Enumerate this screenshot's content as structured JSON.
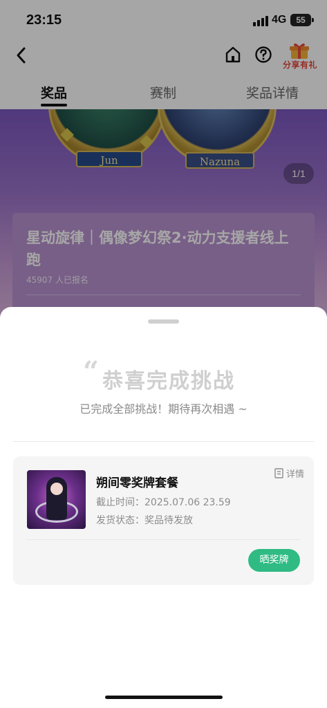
{
  "status_bar": {
    "time": "23:15",
    "network": "4G",
    "battery": "55"
  },
  "nav": {
    "share_label": "分享有礼"
  },
  "tabs": [
    {
      "label": "奖品",
      "active": true
    },
    {
      "label": "赛制",
      "active": false
    },
    {
      "label": "奖品详情",
      "active": false
    }
  ],
  "hero": {
    "medal_left_name": "Jun",
    "medal_right_name": "Nazuna",
    "pager": "1/1"
  },
  "event": {
    "title": "星动旋律｜偶像梦幻祭2·动力支援者线上跑",
    "signup_count": "45907 人已报名"
  },
  "sheet": {
    "quote_mark": "“",
    "title": "恭喜完成挑战",
    "subtitle": "已完成全部挑战！期待再次相遇 ~",
    "prize": {
      "name": "朔间零奖牌套餐",
      "detail_label": "详情",
      "deadline": "截止时间：2025.07.06 23.59",
      "shipping_status": "发货状态：奖品待发放",
      "show_button": "晒奖牌"
    }
  },
  "colors": {
    "accent_green": "#2fbb83",
    "hero_purple": "#7b57c0",
    "share_red": "#e8483b"
  },
  "icons": [
    "back-arrow-icon",
    "home-icon",
    "help-icon",
    "gift-icon",
    "document-icon"
  ]
}
